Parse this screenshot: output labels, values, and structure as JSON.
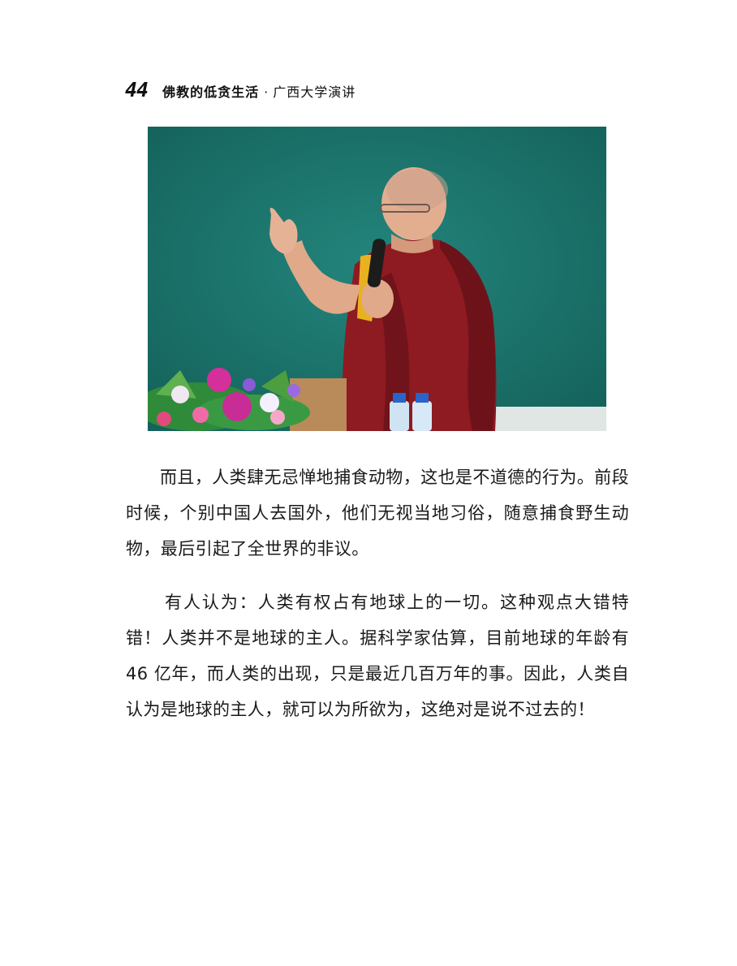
{
  "header": {
    "page_number": "44",
    "title": "佛教的低贪生活",
    "separator": "·",
    "subtitle": "广西大学演讲"
  },
  "photo": {
    "colors": {
      "chalkboard": "#1f7a72",
      "robe": "#8e1a22",
      "robe_shadow": "#5e0f16",
      "sash": "#e8b21f",
      "skin": "#e0a98a"
    }
  },
  "paragraphs": [
    "而且，人类肆无忌惮地捕食动物，这也是不道德的行为。前段时候，个别中国人去国外，他们无视当地习俗，随意捕食野生动物，最后引起了全世界的非议。",
    "有人认为：人类有权占有地球上的一切。这种观点大错特错！人类并不是地球的主人。据科学家估算，目前地球的年龄有 46 亿年，而人类的出现，只是最近几百万年的事。因此，人类自认为是地球的主人，就可以为所欲为，这绝对是说不过去的！"
  ]
}
